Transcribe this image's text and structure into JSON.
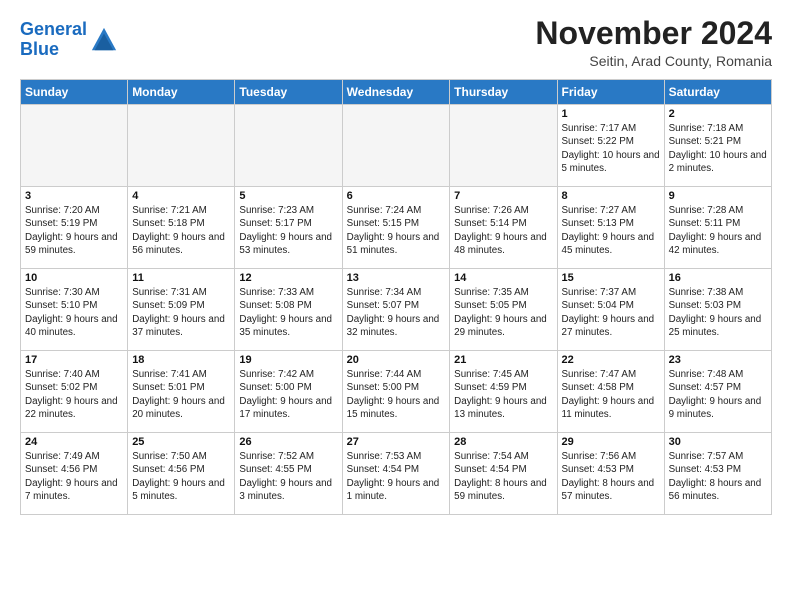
{
  "logo": {
    "line1": "General",
    "line2": "Blue"
  },
  "title": "November 2024",
  "subtitle": "Seitin, Arad County, Romania",
  "days_of_week": [
    "Sunday",
    "Monday",
    "Tuesday",
    "Wednesday",
    "Thursday",
    "Friday",
    "Saturday"
  ],
  "weeks": [
    [
      {
        "day": "",
        "info": ""
      },
      {
        "day": "",
        "info": ""
      },
      {
        "day": "",
        "info": ""
      },
      {
        "day": "",
        "info": ""
      },
      {
        "day": "",
        "info": ""
      },
      {
        "day": "1",
        "info": "Sunrise: 7:17 AM\nSunset: 5:22 PM\nDaylight: 10 hours and 5 minutes."
      },
      {
        "day": "2",
        "info": "Sunrise: 7:18 AM\nSunset: 5:21 PM\nDaylight: 10 hours and 2 minutes."
      }
    ],
    [
      {
        "day": "3",
        "info": "Sunrise: 7:20 AM\nSunset: 5:19 PM\nDaylight: 9 hours and 59 minutes."
      },
      {
        "day": "4",
        "info": "Sunrise: 7:21 AM\nSunset: 5:18 PM\nDaylight: 9 hours and 56 minutes."
      },
      {
        "day": "5",
        "info": "Sunrise: 7:23 AM\nSunset: 5:17 PM\nDaylight: 9 hours and 53 minutes."
      },
      {
        "day": "6",
        "info": "Sunrise: 7:24 AM\nSunset: 5:15 PM\nDaylight: 9 hours and 51 minutes."
      },
      {
        "day": "7",
        "info": "Sunrise: 7:26 AM\nSunset: 5:14 PM\nDaylight: 9 hours and 48 minutes."
      },
      {
        "day": "8",
        "info": "Sunrise: 7:27 AM\nSunset: 5:13 PM\nDaylight: 9 hours and 45 minutes."
      },
      {
        "day": "9",
        "info": "Sunrise: 7:28 AM\nSunset: 5:11 PM\nDaylight: 9 hours and 42 minutes."
      }
    ],
    [
      {
        "day": "10",
        "info": "Sunrise: 7:30 AM\nSunset: 5:10 PM\nDaylight: 9 hours and 40 minutes."
      },
      {
        "day": "11",
        "info": "Sunrise: 7:31 AM\nSunset: 5:09 PM\nDaylight: 9 hours and 37 minutes."
      },
      {
        "day": "12",
        "info": "Sunrise: 7:33 AM\nSunset: 5:08 PM\nDaylight: 9 hours and 35 minutes."
      },
      {
        "day": "13",
        "info": "Sunrise: 7:34 AM\nSunset: 5:07 PM\nDaylight: 9 hours and 32 minutes."
      },
      {
        "day": "14",
        "info": "Sunrise: 7:35 AM\nSunset: 5:05 PM\nDaylight: 9 hours and 29 minutes."
      },
      {
        "day": "15",
        "info": "Sunrise: 7:37 AM\nSunset: 5:04 PM\nDaylight: 9 hours and 27 minutes."
      },
      {
        "day": "16",
        "info": "Sunrise: 7:38 AM\nSunset: 5:03 PM\nDaylight: 9 hours and 25 minutes."
      }
    ],
    [
      {
        "day": "17",
        "info": "Sunrise: 7:40 AM\nSunset: 5:02 PM\nDaylight: 9 hours and 22 minutes."
      },
      {
        "day": "18",
        "info": "Sunrise: 7:41 AM\nSunset: 5:01 PM\nDaylight: 9 hours and 20 minutes."
      },
      {
        "day": "19",
        "info": "Sunrise: 7:42 AM\nSunset: 5:00 PM\nDaylight: 9 hours and 17 minutes."
      },
      {
        "day": "20",
        "info": "Sunrise: 7:44 AM\nSunset: 5:00 PM\nDaylight: 9 hours and 15 minutes."
      },
      {
        "day": "21",
        "info": "Sunrise: 7:45 AM\nSunset: 4:59 PM\nDaylight: 9 hours and 13 minutes."
      },
      {
        "day": "22",
        "info": "Sunrise: 7:47 AM\nSunset: 4:58 PM\nDaylight: 9 hours and 11 minutes."
      },
      {
        "day": "23",
        "info": "Sunrise: 7:48 AM\nSunset: 4:57 PM\nDaylight: 9 hours and 9 minutes."
      }
    ],
    [
      {
        "day": "24",
        "info": "Sunrise: 7:49 AM\nSunset: 4:56 PM\nDaylight: 9 hours and 7 minutes."
      },
      {
        "day": "25",
        "info": "Sunrise: 7:50 AM\nSunset: 4:56 PM\nDaylight: 9 hours and 5 minutes."
      },
      {
        "day": "26",
        "info": "Sunrise: 7:52 AM\nSunset: 4:55 PM\nDaylight: 9 hours and 3 minutes."
      },
      {
        "day": "27",
        "info": "Sunrise: 7:53 AM\nSunset: 4:54 PM\nDaylight: 9 hours and 1 minute."
      },
      {
        "day": "28",
        "info": "Sunrise: 7:54 AM\nSunset: 4:54 PM\nDaylight: 8 hours and 59 minutes."
      },
      {
        "day": "29",
        "info": "Sunrise: 7:56 AM\nSunset: 4:53 PM\nDaylight: 8 hours and 57 minutes."
      },
      {
        "day": "30",
        "info": "Sunrise: 7:57 AM\nSunset: 4:53 PM\nDaylight: 8 hours and 56 minutes."
      }
    ]
  ]
}
